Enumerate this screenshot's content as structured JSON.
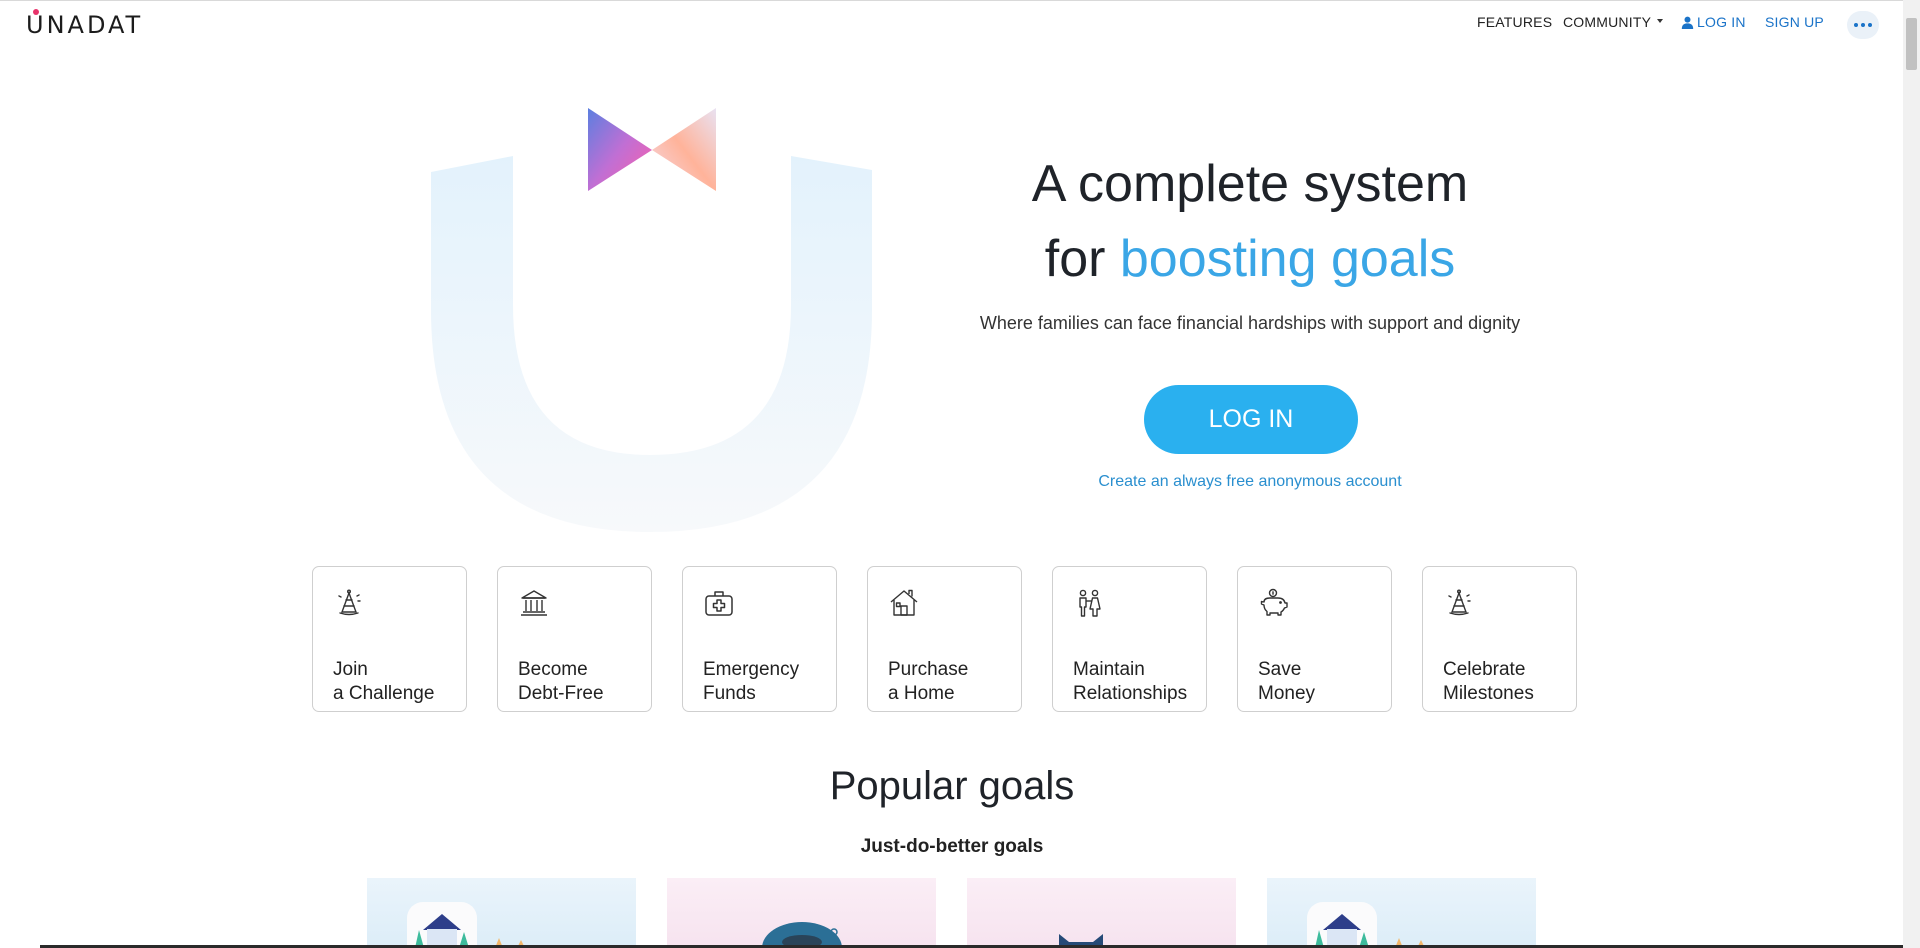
{
  "brand": {
    "name": "UNADAT"
  },
  "nav": {
    "features": "FEATURES",
    "community": "COMMUNITY",
    "login": "LOG IN",
    "signup": "SIGN UP",
    "more_icon": "more-dots-icon"
  },
  "hero": {
    "title_line1": "A complete system",
    "title_line2_prefix": "for ",
    "title_line2_accent": "boosting goals",
    "subtitle": "Where families can face financial hardships with support and dignity",
    "login_button": "LOG IN",
    "create_account": "Create an always free anonymous account",
    "accent_color": "#3aa6e6",
    "button_color": "#2ab0ef"
  },
  "categories": [
    {
      "line1": "Join",
      "line2": "a Challenge",
      "icon": "party-hat-icon"
    },
    {
      "line1": "Become",
      "line2": "Debt-Free",
      "icon": "bank-icon"
    },
    {
      "line1": "Emergency",
      "line2": "Funds",
      "icon": "first-aid-kit-icon"
    },
    {
      "line1": "Purchase",
      "line2": "a Home",
      "icon": "house-icon"
    },
    {
      "line1": "Maintain",
      "line2": "Relationships",
      "icon": "couple-icon"
    },
    {
      "line1": "Save",
      "line2": "Money",
      "icon": "piggy-bank-icon"
    },
    {
      "line1": "Celebrate",
      "line2": "Milestones",
      "icon": "party-hat-icon"
    }
  ],
  "popular": {
    "title": "Popular goals",
    "subtitle": "Just-do-better goals"
  }
}
